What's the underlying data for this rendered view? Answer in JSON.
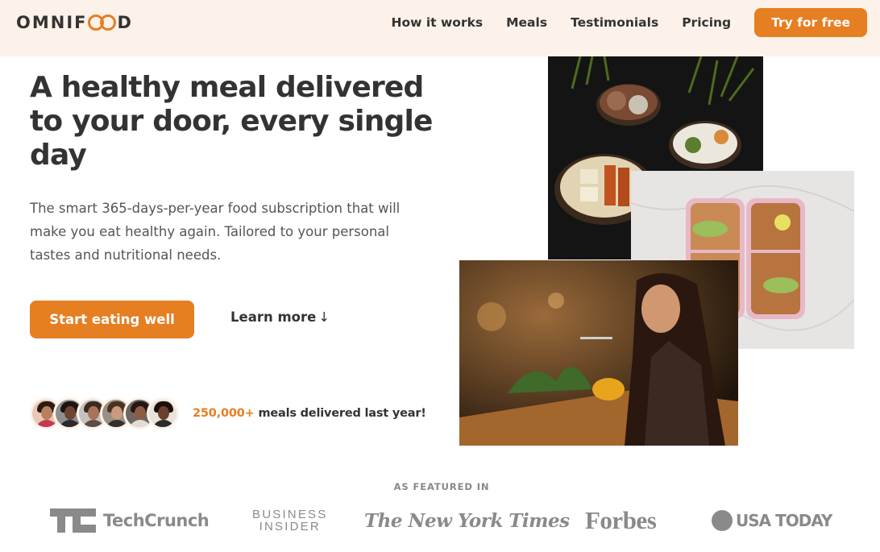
{
  "brand": {
    "logo_text_left": "OMNIF",
    "logo_text_right": "D",
    "accent": "#e67e22",
    "header_bg": "#fdf2e9"
  },
  "nav": {
    "links": [
      "How it works",
      "Meals",
      "Testimonials",
      "Pricing"
    ],
    "cta": "Try for free"
  },
  "hero": {
    "title": "A healthy meal delivered to your door, every single day",
    "description": "The smart 365-days-per-year food subscription that will make you eat healthy again. Tailored to your personal tastes and nutritional needs.",
    "primary_button": "Start eating well",
    "secondary_button": "Learn more",
    "secondary_arrow": "↓"
  },
  "delivered": {
    "count": "250,000+",
    "text": "meals delivered last year!"
  },
  "images": {
    "bowls": "image-food-bowls",
    "boxes": "image-meal-prep-boxes",
    "woman": "image-woman-eating"
  },
  "featured": {
    "title": "AS FEATURED IN",
    "logos": {
      "techcrunch": "TechCrunch",
      "business_insider_1": "BUSINESS",
      "business_insider_2": "INSIDER",
      "nyt": "The New York Times",
      "forbes": "Forbes",
      "usatoday": "USA TODAY"
    }
  }
}
